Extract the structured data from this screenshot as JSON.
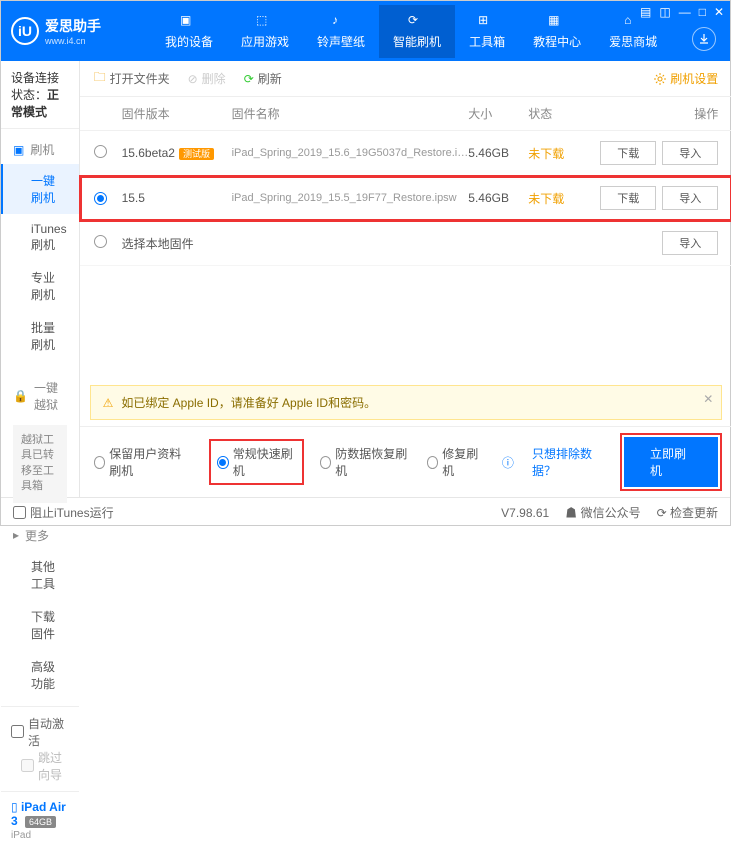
{
  "app": {
    "title": "爱思助手",
    "sub": "www.i4.cn",
    "logo_letter": "iU"
  },
  "nav": [
    {
      "label": "我的设备"
    },
    {
      "label": "应用游戏"
    },
    {
      "label": "铃声壁纸"
    },
    {
      "label": "智能刷机",
      "active": true
    },
    {
      "label": "工具箱"
    },
    {
      "label": "教程中心"
    },
    {
      "label": "爱思商城"
    }
  ],
  "sidebar": {
    "conn_label": "设备连接状态：",
    "conn_value": "正常模式",
    "sec_flash": "刷机",
    "items_flash": [
      {
        "label": "一键刷机",
        "active": true
      },
      {
        "label": "iTunes刷机"
      },
      {
        "label": "专业刷机"
      },
      {
        "label": "批量刷机"
      }
    ],
    "sec_jb": "一键越狱",
    "jb_note": "越狱工具已转移至工具箱",
    "sec_more": "更多",
    "items_more": [
      {
        "label": "其他工具"
      },
      {
        "label": "下载固件"
      },
      {
        "label": "高级功能"
      }
    ],
    "auto_act": "自动激活",
    "skip_guide": "跳过向导",
    "device_name": "iPad Air 3",
    "device_storage": "64GB",
    "device_type": "iPad"
  },
  "toolbar": {
    "open": "打开文件夹",
    "delete": "删除",
    "refresh": "刷新",
    "settings": "刷机设置"
  },
  "columns": {
    "ver": "固件版本",
    "name": "固件名称",
    "size": "大小",
    "status": "状态",
    "ops": "操作"
  },
  "rows": [
    {
      "ver": "15.6beta2",
      "badge": "测试版",
      "name": "iPad_Spring_2019_15.6_19G5037d_Restore.i…",
      "size": "5.46GB",
      "status": "未下载",
      "selected": false
    },
    {
      "ver": "15.5",
      "name": "iPad_Spring_2019_15.5_19F77_Restore.ipsw",
      "size": "5.46GB",
      "status": "未下载",
      "selected": true
    }
  ],
  "local_fw": "选择本地固件",
  "btns": {
    "download": "下载",
    "import": "导入"
  },
  "warning": "如已绑定 Apple ID，请准备好 Apple ID和密码。",
  "opts": {
    "keep": "保留用户资料刷机",
    "normal": "常规快速刷机",
    "anti": "防数据恢复刷机",
    "repair": "修复刷机",
    "exclude": "只想排除数据？",
    "go": "立即刷机"
  },
  "footer": {
    "block": "阻止iTunes运行",
    "ver": "V7.98.61",
    "wechat": "微信公众号",
    "check": "检查更新"
  }
}
